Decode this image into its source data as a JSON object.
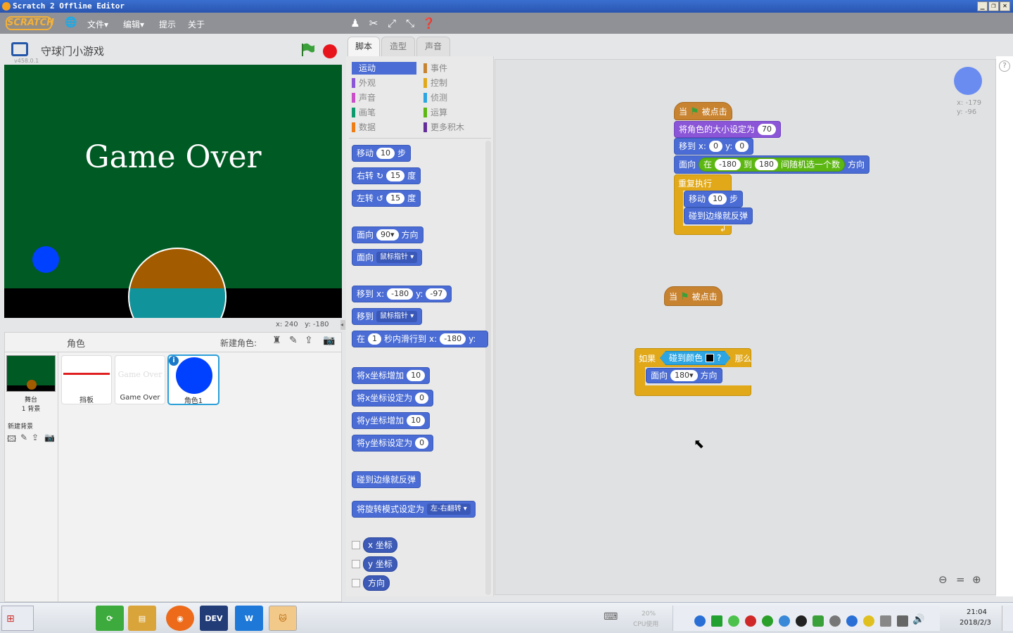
{
  "window": {
    "title": "Scratch 2 Offline Editor"
  },
  "menu": {
    "logo": "SCRATCH",
    "file": "文件▾",
    "edit": "编辑▾",
    "tips": "提示",
    "about": "关于"
  },
  "stage": {
    "project_title": "守球门小游戏",
    "version": "v458.0.1",
    "game_over_text": "Game Over",
    "coords_x": "x: 240",
    "coords_y": "y: -180"
  },
  "sprite_panel": {
    "header": "角色",
    "new_sprite_label": "新建角色:",
    "stage_label": "舞台",
    "stage_backdrops": "1 背景",
    "new_backdrop_label": "新建背景",
    "sprites": [
      {
        "name": "挡板"
      },
      {
        "name": "Game Over",
        "thumb_text": "Game Over"
      },
      {
        "name": "角色1"
      }
    ]
  },
  "tabs": {
    "scripts": "脚本",
    "costumes": "造型",
    "sounds": "声音"
  },
  "categories": {
    "motion": "运动",
    "looks": "外观",
    "sound": "声音",
    "pen": "画笔",
    "data": "数据",
    "events": "事件",
    "control": "控制",
    "sensing": "侦测",
    "operators": "运算",
    "more": "更多积木"
  },
  "colors": {
    "motion": "#4a6cd4",
    "looks": "#8a55d7",
    "sound": "#c94fc9",
    "pen": "#0e9a6c",
    "data": "#ee7d16",
    "events": "#c88330",
    "control": "#e1a91a",
    "sensing": "#2ca5e2",
    "operators": "#5cb712",
    "more": "#632d99",
    "stage_bg": "#005a23"
  },
  "palette": {
    "move": "移动",
    "move_steps": "10",
    "steps": "步",
    "turn_right": "右转",
    "turn_right_deg": "15",
    "turn_left": "左转",
    "turn_left_deg": "15",
    "degrees": "度",
    "point_dir": "面向",
    "point_dir_val": "90▾",
    "direction": "方向",
    "point_towards": "面向",
    "towards_dd": "鼠标指针 ▾",
    "goto": "移到",
    "goto_x_label": "x:",
    "goto_x": "-180",
    "goto_y_label": "y:",
    "goto_y": "-97",
    "goto_to": "移到",
    "goto_dd": "鼠标指针 ▾",
    "glide_in": "在",
    "glide_secs": "1",
    "glide_to": "秒内滑行到",
    "glide_x_label": "x:",
    "glide_x": "-180",
    "glide_y_label": "y:",
    "change_x": "将x坐标增加",
    "change_x_val": "10",
    "set_x": "将x坐标设定为",
    "set_x_val": "0",
    "change_y": "将y坐标增加",
    "change_y_val": "10",
    "set_y": "将y坐标设定为",
    "set_y_val": "0",
    "bounce": "碰到边缘就反弹",
    "rotation_style": "将旋转模式设定为",
    "rotation_dd": "左-右翻转 ▾",
    "x_pos": "x 坐标",
    "y_pos": "y 坐标",
    "dir_rep": "方向"
  },
  "scripts": {
    "s1_when": "当",
    "s1_clicked": "被点击",
    "s1_size": "将角色的大小设定为",
    "s1_size_val": "70",
    "s1_goto": "移到 x:",
    "s1_x": "0",
    "s1_y_label": "y:",
    "s1_y": "0",
    "s1_point": "面向",
    "s1_pick_in": "在",
    "s1_from": "-180",
    "s1_to_label": "到",
    "s1_to": "180",
    "s1_pick": "间随机选一个数",
    "s1_dir": "方向",
    "s1_forever": "重复执行",
    "s1_move": "移动",
    "s1_move_val": "10",
    "s1_steps": "步",
    "s1_bounce": "碰到边缘就反弹",
    "s2_when": "当",
    "s2_clicked": "被点击",
    "s3_if": "如果",
    "s3_touch": "碰到颜色",
    "s3_q": "?",
    "s3_then": "那么",
    "s3_point": "面向",
    "s3_val": "180▾",
    "s3_dir": "方向"
  },
  "sprite_info": {
    "x": "x: -179",
    "y": "y: -96"
  },
  "taskbar": {
    "cpu_pct": "20%",
    "cpu_label": "CPU使用",
    "time": "21:04",
    "date": "2018/2/3",
    "dev_label": "DEV"
  }
}
